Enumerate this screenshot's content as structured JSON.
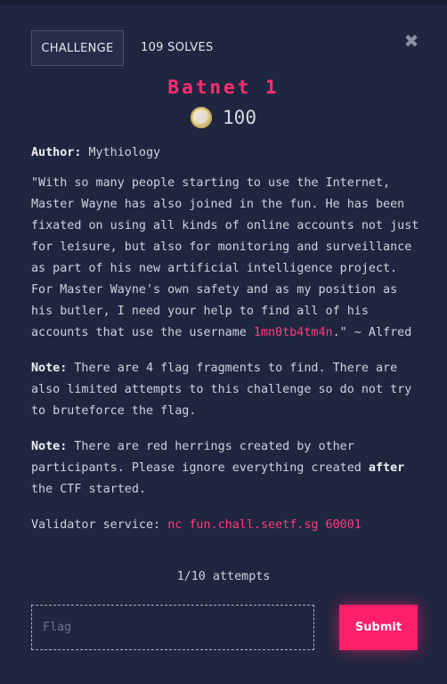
{
  "header": {
    "tab_label": "CHALLENGE",
    "solves": "109 SOLVES",
    "close_glyph": "✖"
  },
  "challenge": {
    "title": "Batnet 1",
    "points": "100",
    "coin_icon": "coin-icon"
  },
  "description": {
    "author_label": "Author:",
    "author_name": "Mythiology",
    "quote_text": "\"With so many people starting to use the Internet, Master Wayne has also joined in the fun. He has been fixated on using all kinds of online accounts not just for leisure, but also for monitoring and surveillance as part of his new artificial intelligence project. For Master Wayne's own safety and as my position as his butler, I need your help to find all of his accounts that use the username ",
    "username": "1mn0tb4tm4n",
    "quote_end": ".\" ~ Alfred",
    "note1_label": "Note:",
    "note1_text": "There are 4 flag fragments to find. There are also limited attempts to this challenge so do not try to bruteforce the flag.",
    "note2_label": "Note:",
    "note2_text_before": "There are red herrings created by other participants. Please ignore everything created ",
    "note2_emphasis": "after",
    "note2_text_after": " the CTF started.",
    "validator_label": "Validator service:",
    "validator_cmd": "nc fun.chall.seetf.sg 60001"
  },
  "submission": {
    "attempts": "1/10 attempts",
    "flag_placeholder": "Flag",
    "flag_value": "",
    "submit_label": "Submit"
  },
  "colors": {
    "background": "#1f2640",
    "accent": "#ff1f6a",
    "title": "#ff2e73"
  }
}
